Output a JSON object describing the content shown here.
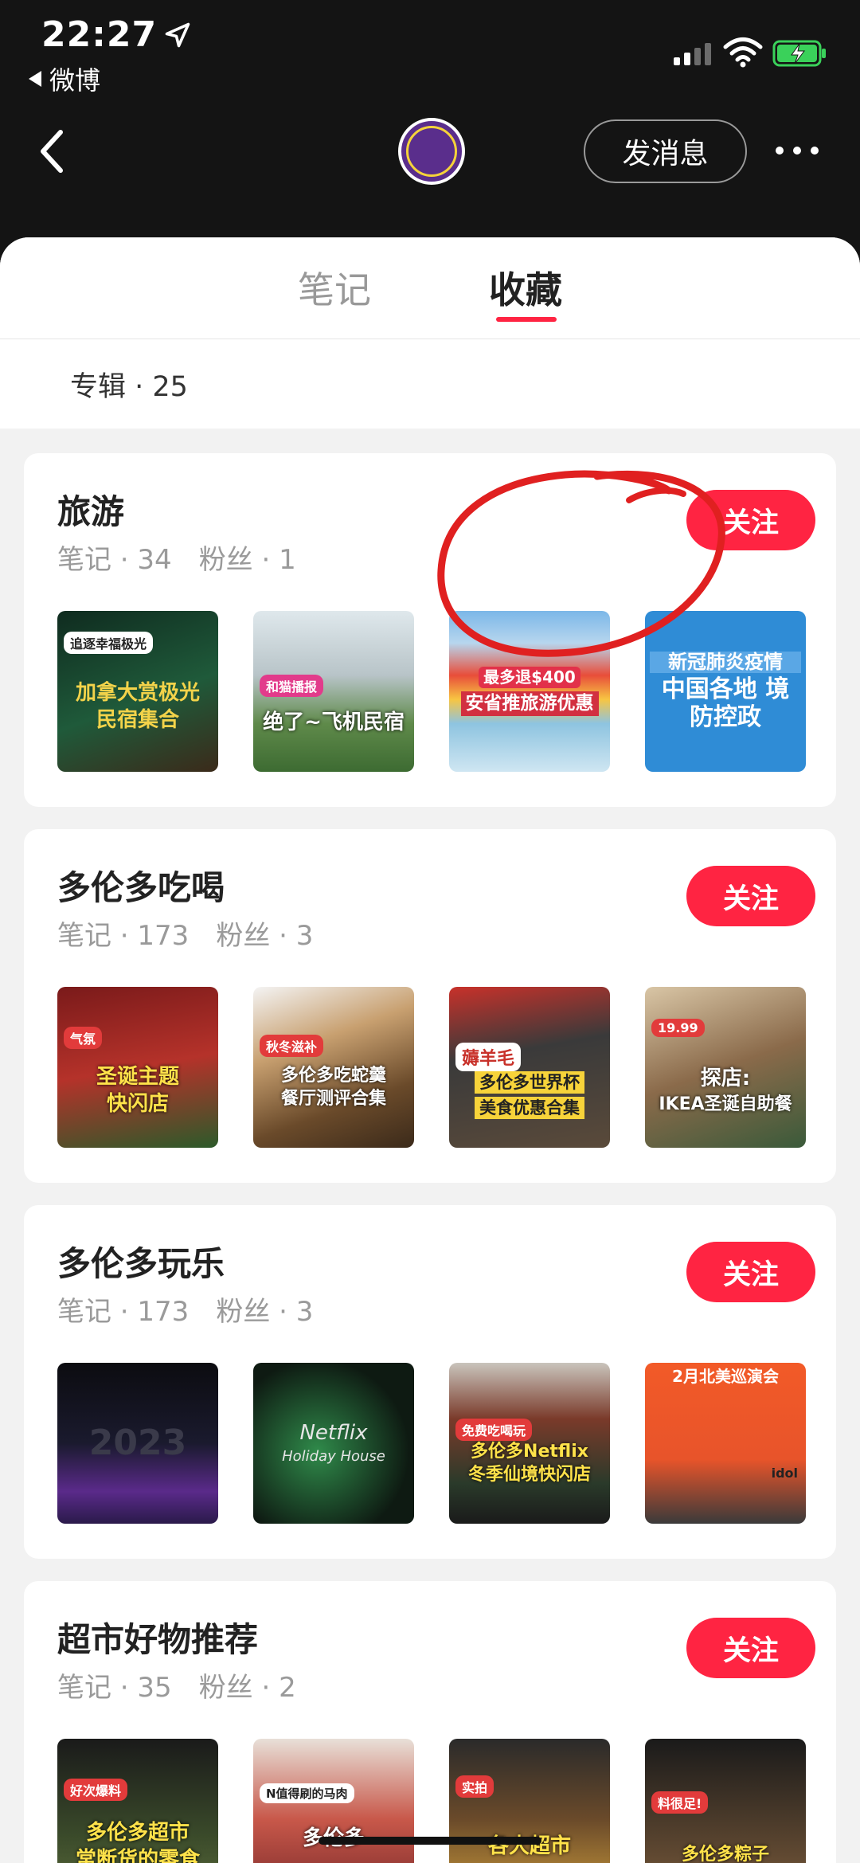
{
  "status_bar": {
    "time": "22:27",
    "back_app": "微博"
  },
  "header": {
    "message_button": "发消息",
    "colors": {
      "background": "#141414"
    }
  },
  "tabs": [
    {
      "label": "笔记",
      "active": false
    },
    {
      "label": "收藏",
      "active": true
    }
  ],
  "album_bar": {
    "label": "专辑 · 25"
  },
  "accent_color": "#ff2442",
  "albums": [
    {
      "title": "旅游",
      "notes": "笔记 · 34",
      "fans": "粉丝 · 1",
      "follow": "关注",
      "thumbs": [
        {
          "line1": "加拿大赏极光",
          "line2": "民宿集合",
          "tag": "追逐幸福极光"
        },
        {
          "line1": "绝了~飞机民宿",
          "line2": "",
          "tag": "和猫播报"
        },
        {
          "line1": "最多退$400",
          "line2": "安省推旅游优惠",
          "tag": ""
        },
        {
          "line1": "新冠肺炎疫情",
          "line2": "中国各地 境防控政",
          "tag": ""
        }
      ]
    },
    {
      "title": "多伦多吃喝",
      "notes": "笔记 · 173",
      "fans": "粉丝 · 3",
      "follow": "关注",
      "thumbs": [
        {
          "line1": "圣诞主题",
          "line2": "快闪店",
          "tag": "气氛"
        },
        {
          "line1": "多伦多吃蛇羹",
          "line2": "餐厅测评合集",
          "tag": "秋冬滋补"
        },
        {
          "line1": "多伦多世界杯",
          "line2": "美食优惠合集",
          "tag": "薅羊毛"
        },
        {
          "line1": "探店:",
          "line2": "IKEA圣诞自助餐",
          "tag": "19.99"
        }
      ]
    },
    {
      "title": "多伦多玩乐",
      "notes": "笔记 · 173",
      "fans": "粉丝 · 3",
      "follow": "关注",
      "thumbs": [
        {
          "line1": "2023",
          "line2": "",
          "tag": ""
        },
        {
          "line1": "Netflix",
          "line2": "Holiday House",
          "tag": ""
        },
        {
          "line1": "多伦多Netflix",
          "line2": "冬季仙境快闪店",
          "tag": "免费吃喝玩"
        },
        {
          "line1": "2月北美巡演会",
          "line2": "idol",
          "tag": ""
        }
      ]
    },
    {
      "title": "超市好物推荐",
      "notes": "笔记 · 35",
      "fans": "粉丝 · 2",
      "follow": "关注",
      "thumbs": [
        {
          "line1": "多伦多超市",
          "line2": "常断货的零食",
          "tag": "好次爆料"
        },
        {
          "line1": "多伦多",
          "line2": "",
          "tag": "N值得刷的马肉"
        },
        {
          "line1": "各大超市",
          "line2": "",
          "tag": "实拍"
        },
        {
          "line1": "多伦多粽子",
          "line2": "",
          "tag": "料很足!"
        }
      ]
    }
  ]
}
